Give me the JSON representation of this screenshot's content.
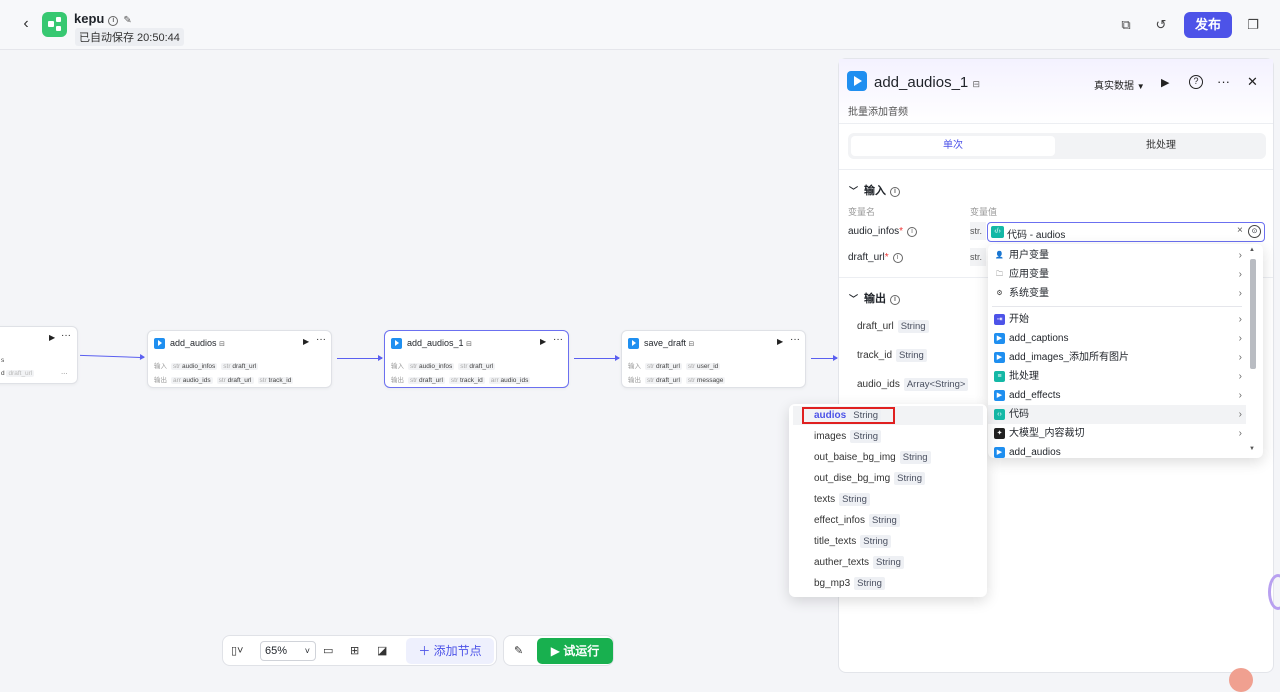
{
  "app": {
    "name": "kepu",
    "saved_text": "已自动保存 20:50:44",
    "publish_label": "发布"
  },
  "nodes": {
    "add_audios": {
      "title": "add_audios",
      "in_label": "输入",
      "out_label": "输出",
      "inputs": [
        "audio_infos",
        "draft_url"
      ],
      "outputs": [
        "audio_ids",
        "draft_url",
        "track_id"
      ],
      "in_types": [
        "str",
        "str"
      ],
      "out_types": [
        "arr",
        "str",
        "str"
      ]
    },
    "add_audios_1": {
      "title": "add_audios_1",
      "in_label": "输入",
      "out_label": "输出",
      "inputs": [
        "audio_infos",
        "draft_url"
      ],
      "outputs": [
        "draft_url",
        "track_id",
        "audio_ids"
      ],
      "in_types": [
        "str",
        "str"
      ],
      "out_types": [
        "str",
        "str",
        "arr"
      ]
    },
    "save_draft": {
      "title": "save_draft",
      "in_label": "输入",
      "out_label": "输出",
      "inputs": [
        "draft_url",
        "user_id"
      ],
      "outputs": [
        "draft_url",
        "message"
      ],
      "in_types": [
        "str",
        "str"
      ],
      "out_types": [
        "str",
        "str"
      ]
    },
    "left_partial": {
      "row1": "s",
      "row2_a": "d",
      "row2_b": "draft_url"
    }
  },
  "toolbar": {
    "zoom": "65%",
    "add_node_label": "添加节点",
    "trial_run_label": "试运行"
  },
  "panel": {
    "title": "add_audios_1",
    "description": "批量添加音频",
    "data_mode": "真实数据",
    "tabs": [
      "单次",
      "批处理"
    ],
    "input_section": "输入",
    "output_section": "输出",
    "col_name": "变量名",
    "col_value": "变量值",
    "inputs": [
      {
        "name": "audio_infos",
        "type": "str.",
        "value": "代码 - audios"
      },
      {
        "name": "draft_url",
        "type": "str."
      }
    ],
    "outputs": [
      {
        "name": "draft_url",
        "type": "String"
      },
      {
        "name": "track_id",
        "type": "String"
      },
      {
        "name": "audio_ids",
        "type": "Array<String>"
      }
    ]
  },
  "menu": {
    "groups": [
      "用户变量",
      "应用变量",
      "系统变量"
    ],
    "nodes": [
      "开始",
      "add_captions",
      "add_images_添加所有图片",
      "批处理",
      "add_effects",
      "代码",
      "大模型_内容裁切",
      "add_audios"
    ]
  },
  "submenu": [
    {
      "name": "audios",
      "type": "String"
    },
    {
      "name": "images",
      "type": "String"
    },
    {
      "name": "out_baise_bg_img",
      "type": "String"
    },
    {
      "name": "out_dise_bg_img",
      "type": "String"
    },
    {
      "name": "texts",
      "type": "String"
    },
    {
      "name": "effect_infos",
      "type": "String"
    },
    {
      "name": "title_texts",
      "type": "String"
    },
    {
      "name": "auther_texts",
      "type": "String"
    },
    {
      "name": "bg_mp3",
      "type": "String"
    }
  ],
  "colors": {
    "accent": "#4d53e8",
    "run": "#18b04f",
    "highlight": "#e02020"
  }
}
